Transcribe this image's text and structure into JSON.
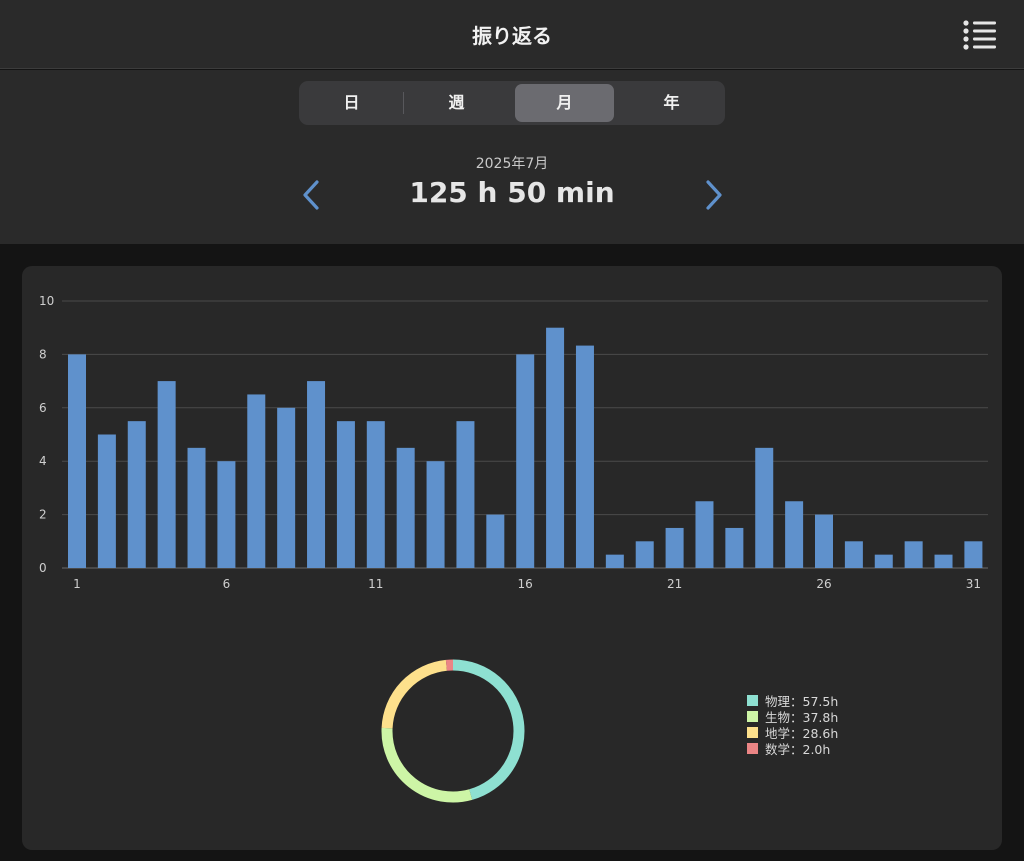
{
  "navbar": {
    "title": "振り返る",
    "menu_icon": "list-icon"
  },
  "segments": [
    {
      "label": "日",
      "active": false
    },
    {
      "label": "週",
      "active": false
    },
    {
      "label": "月",
      "active": true
    },
    {
      "label": "年",
      "active": false
    }
  ],
  "period": {
    "label": "2025年7月",
    "total": "125 h 50 min"
  },
  "colors": {
    "bar": "#5f91cc",
    "background": "#141414",
    "card": "#282828",
    "accent": "#5f91cc"
  },
  "chart_data": [
    {
      "type": "bar",
      "x": [
        1,
        2,
        3,
        4,
        5,
        6,
        7,
        8,
        9,
        10,
        11,
        12,
        13,
        14,
        15,
        16,
        17,
        18,
        19,
        20,
        21,
        22,
        23,
        24,
        25,
        26,
        27,
        28,
        29,
        30,
        31
      ],
      "values": [
        8,
        5,
        5.5,
        7,
        4.5,
        4,
        6.5,
        6,
        7,
        5.5,
        5.5,
        4.5,
        4,
        5.5,
        2,
        8,
        9,
        8.33,
        0.5,
        1,
        1.5,
        2.5,
        1.5,
        4.5,
        2.5,
        2,
        1,
        0.5,
        1,
        0.5,
        1
      ],
      "xticks": [
        "1",
        "6",
        "11",
        "16",
        "21",
        "26",
        "31"
      ],
      "yticks": [
        "0",
        "2",
        "4",
        "6",
        "8",
        "10"
      ],
      "ylim": [
        0,
        10
      ],
      "grid": true
    },
    {
      "type": "pie",
      "style": "donut",
      "labels": [
        "物理",
        "生物",
        "地学",
        "数学"
      ],
      "values": [
        57.5,
        37.8,
        28.6,
        2.0
      ],
      "legend_text": [
        "物理：57.5h",
        "生物：37.8h",
        "地学：28.6h",
        "数学：2.0h"
      ],
      "colors": [
        "#8ee0d1",
        "#cdf5a6",
        "#fde08c",
        "#eb8585"
      ],
      "legend_position": "right"
    }
  ]
}
